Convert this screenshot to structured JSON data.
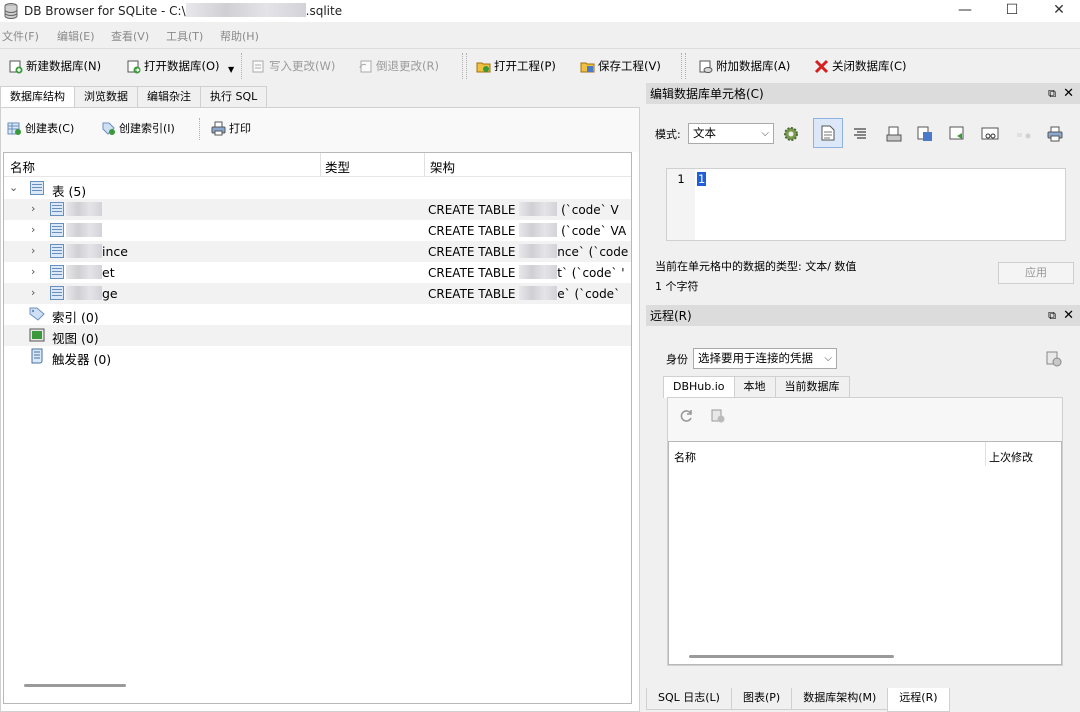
{
  "window": {
    "title_prefix": "DB Browser for SQLite - C:\\",
    "title_suffix": ".sqlite",
    "minimize": "—",
    "maximize": "☐",
    "close": "✕"
  },
  "menu": [
    "文件(F)",
    "编辑(E)",
    "查看(V)",
    "工具(T)",
    "帮助(H)"
  ],
  "toolbar": {
    "new_db": "新建数据库(N)",
    "open_db": "打开数据库(O)",
    "write_changes": "写入更改(W)",
    "revert_changes": "倒退更改(R)",
    "open_project": "打开工程(P)",
    "save_project": "保存工程(V)",
    "attach_db": "附加数据库(A)",
    "close_db": "关闭数据库(C)"
  },
  "left_tabs": [
    "数据库结构",
    "浏览数据",
    "编辑杂注",
    "执行 SQL"
  ],
  "structure_toolbar": {
    "create_table": "创建表(C)",
    "create_index": "创建索引(I)",
    "print": "打印"
  },
  "tree": {
    "columns": {
      "name": "名称",
      "type": "类型",
      "schema": "架构"
    },
    "tables_node": "表 (5)",
    "tables": [
      {
        "name_visible": "",
        "schema_prefix": "CREATE TABLE",
        "schema_suffix": " (`code` V"
      },
      {
        "name_visible": "",
        "schema_prefix": "CREATE TABLE",
        "schema_suffix": " (`code` VA"
      },
      {
        "name_visible": "ince",
        "schema_prefix": "CREATE TABLE",
        "schema_suffix": "nce` (`code"
      },
      {
        "name_visible": "et",
        "schema_prefix": "CREATE TABLE",
        "schema_suffix": "t` (`code` '"
      },
      {
        "name_visible": "ge",
        "schema_prefix": "CREATE TABLE",
        "schema_suffix": "e` (`code`"
      }
    ],
    "indexes_node": "索引 (0)",
    "views_node": "视图 (0)",
    "triggers_node": "触发器 (0)"
  },
  "edit_cell": {
    "title": "编辑数据库单元格(C)",
    "mode_label": "模式:",
    "mode_value": "文本",
    "line_number": "1",
    "cell_value": "1",
    "type_info": "当前在单元格中的数据的类型: 文本/ 数值",
    "char_count": "1 个字符",
    "apply": "应用"
  },
  "remote": {
    "title": "远程(R)",
    "identity_label": "身份",
    "identity_value": "选择要用于连接的凭据",
    "tabs": [
      "DBHub.io",
      "本地",
      "当前数据库"
    ],
    "col_name": "名称",
    "col_modified": "上次修改"
  },
  "bottom_tabs": [
    "SQL 日志(L)",
    "图表(P)",
    "数据库架构(M)",
    "远程(R)"
  ],
  "colors": {
    "accent": "#1f5fd6",
    "close_red": "#d42020",
    "dock_title": "#dcdcdc"
  }
}
